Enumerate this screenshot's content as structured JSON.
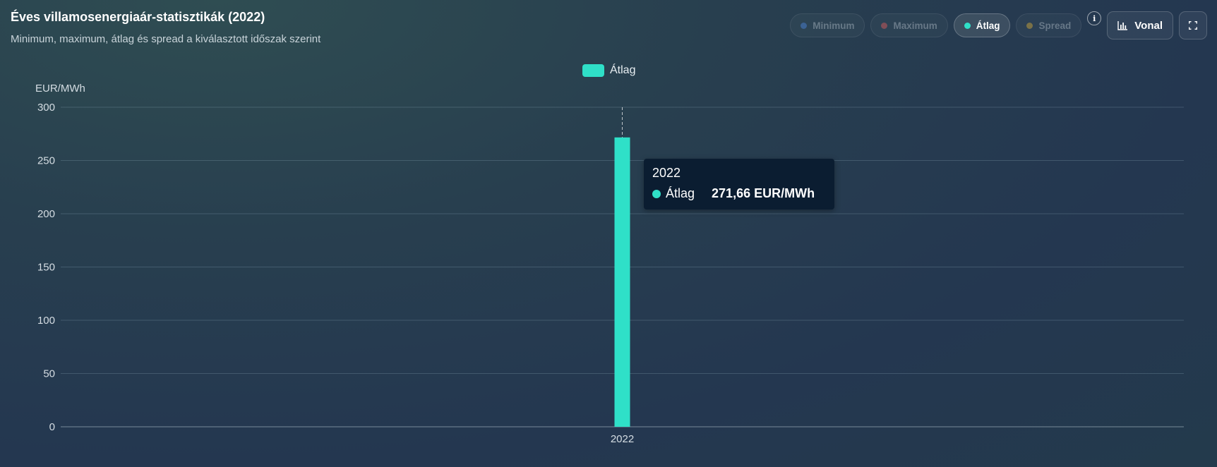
{
  "header": {
    "title": "Éves villamosenergiaár-statisztikák (2022)",
    "subtitle": "Minimum, maximum, átlag és spread a kiválasztott időszak szerint"
  },
  "toolbar": {
    "toggles": [
      {
        "label": "Minimum",
        "color": "#4a7fd4",
        "active": false
      },
      {
        "label": "Maximum",
        "color": "#d45a5a",
        "active": false
      },
      {
        "label": "Átlag",
        "color": "#2fe0c8",
        "active": true
      },
      {
        "label": "Spread",
        "color": "#c9a13a",
        "active": false
      }
    ],
    "info_label": "i",
    "chart_type_label": "Vonal"
  },
  "legend": {
    "label": "Átlag",
    "color": "#2fe0c8"
  },
  "tooltip": {
    "title": "2022",
    "series": "Átlag",
    "value": "271,66 EUR/MWh"
  },
  "chart_data": {
    "type": "bar",
    "categories": [
      "2022"
    ],
    "series": [
      {
        "name": "Átlag",
        "values": [
          271.66
        ],
        "color": "#2fe0c8"
      }
    ],
    "ylabel": "EUR/MWh",
    "ylim": [
      0,
      300
    ],
    "yticks": [
      0,
      50,
      100,
      150,
      200,
      250,
      300
    ],
    "grid": true,
    "legend_position": "top-center"
  }
}
